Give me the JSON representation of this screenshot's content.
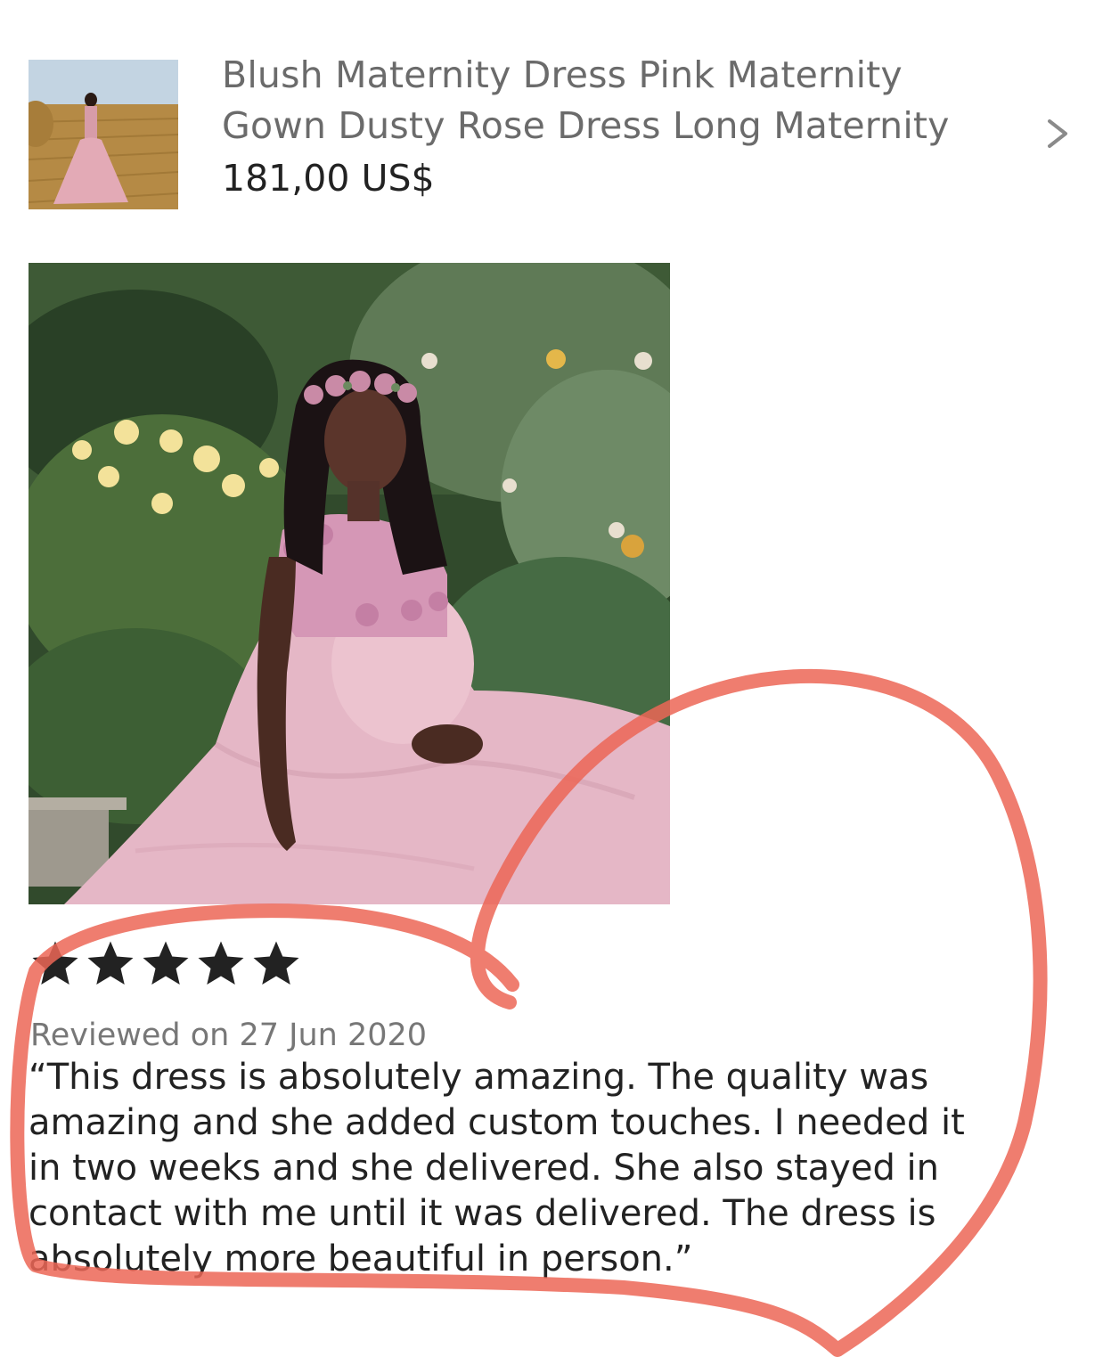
{
  "product": {
    "title_line1": "Blush Maternity Dress Pink Maternity",
    "title_line2": "Gown Dusty Rose Dress Long Maternity",
    "price": "181,00 US$",
    "thumbnail_icon": "product-thumbnail",
    "navigate_icon": "chevron-right-icon"
  },
  "review": {
    "photo_icon": "review-photo",
    "rating": 5,
    "rating_max": 5,
    "date": "Reviewed on 27 Jun 2020",
    "text": "“This dress is absolutely amazing. The quality was\namazing and she added custom touches. I needed it\nin two weeks and she delivered. She also stayed in\ncontact with me until it was delivered. The dress is\nabsolutely more beautiful in person.”"
  },
  "annotation": {
    "shape": "hand-drawn-heart",
    "color": "#ec6656"
  },
  "colors": {
    "title_gray": "#6b6b6b",
    "text_dark": "#222222",
    "date_gray": "#777777",
    "star": "#222222"
  }
}
